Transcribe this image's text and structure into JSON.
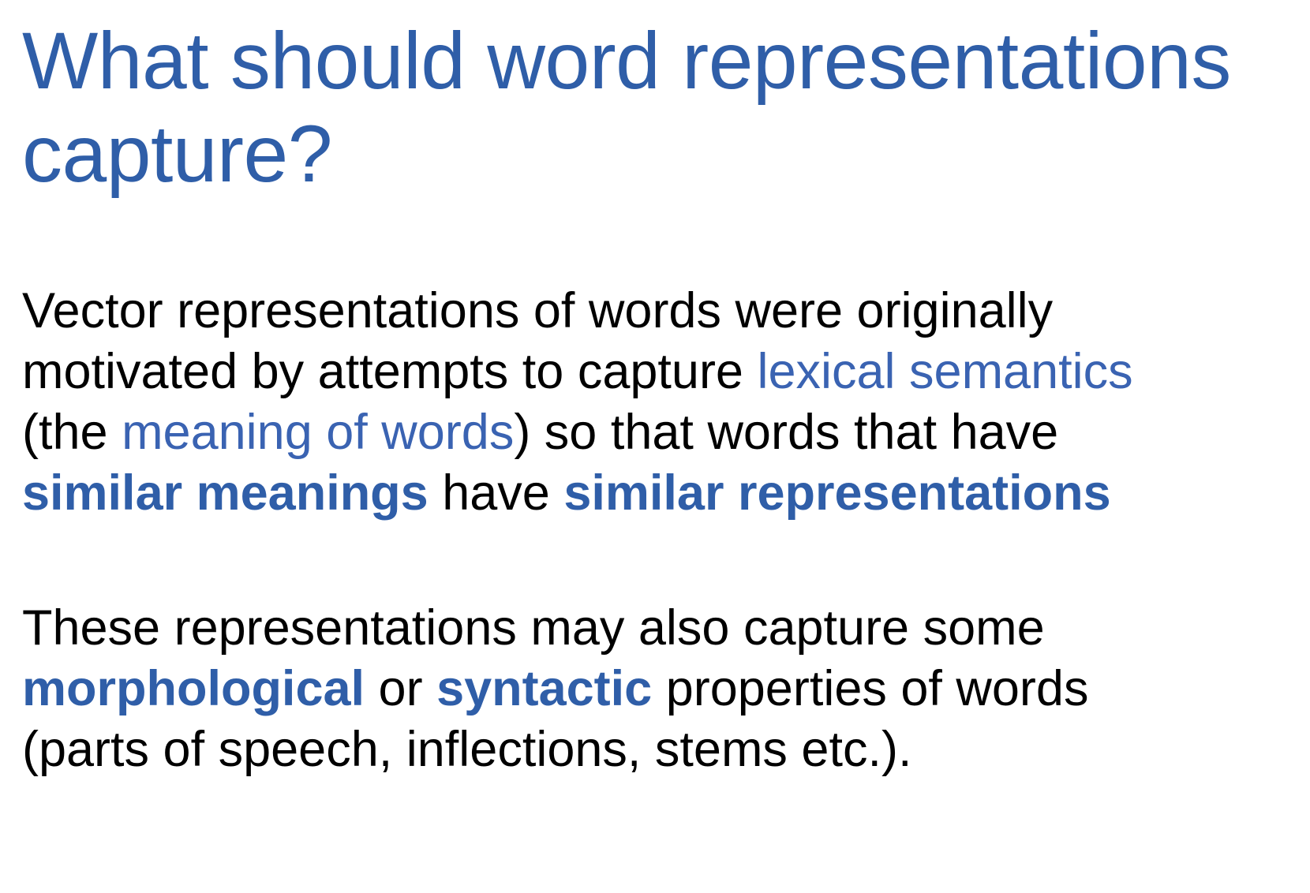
{
  "slide": {
    "title": "What should word representations capture?",
    "paragraph1": {
      "line1": {
        "text": "Vector representations of words were originally"
      },
      "line2": {
        "before": "motivated by attempts to capture ",
        "highlight": "lexical semantics"
      },
      "line3": {
        "before": "(the ",
        "highlight": "meaning of words",
        "after": ") so that words that have"
      },
      "line4": {
        "bold1": "similar meanings",
        "middle": " have ",
        "bold2": "similar representations"
      }
    },
    "paragraph2": {
      "line1": {
        "text": "These representations may also capture some"
      },
      "line2": {
        "bold1": "morphological",
        "middle": " or ",
        "bold2": "syntactic",
        "after": " properties of words"
      },
      "line3": {
        "text": "(parts of speech, inflections, stems etc.)."
      }
    },
    "colors": {
      "title": "#2f5ea8",
      "highlight": "#3a63b2",
      "body": "#000000",
      "background": "#ffffff"
    }
  }
}
